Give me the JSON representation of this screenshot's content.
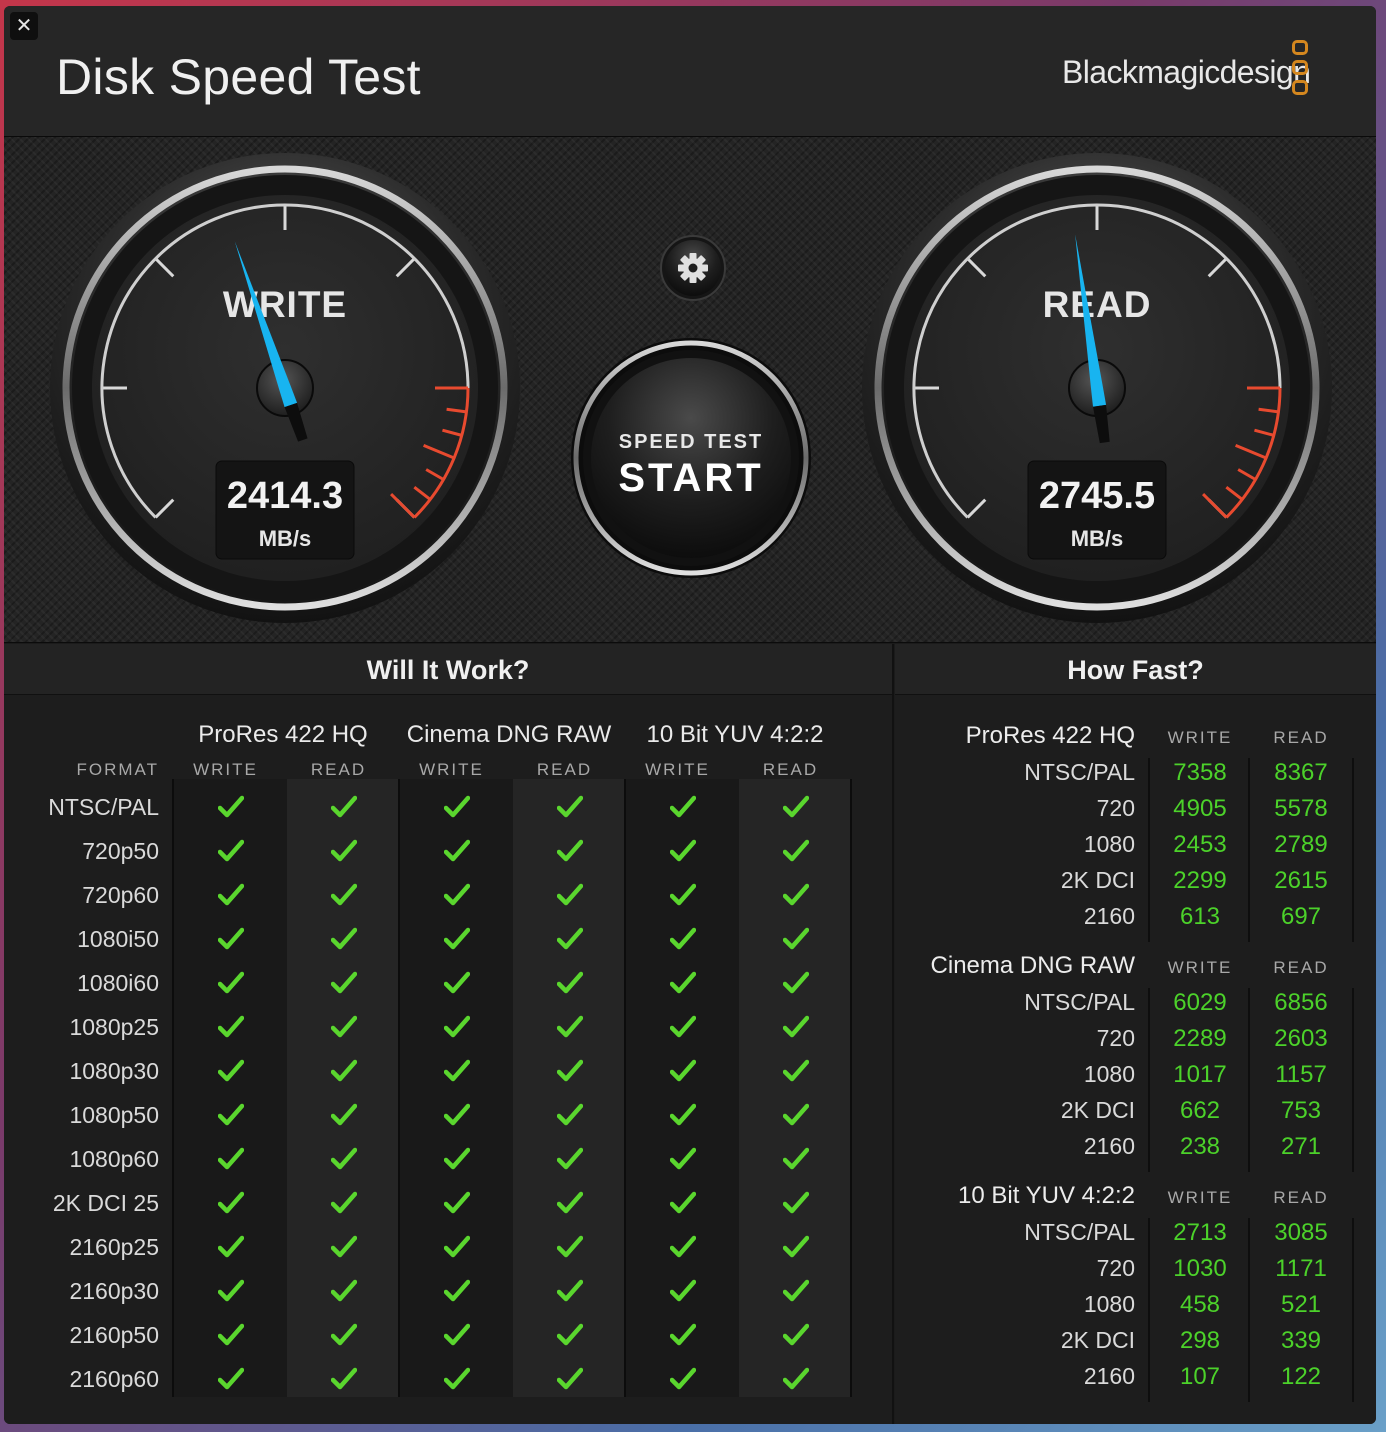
{
  "window": {
    "title": "Disk Speed Test",
    "brand": "Blackmagicdesign",
    "close_glyph": "✕"
  },
  "gauges": {
    "write": {
      "label": "WRITE",
      "value": "2414.3",
      "unit": "MB/s",
      "needle_fraction": 0.43
    },
    "read": {
      "label": "READ",
      "value": "2745.5",
      "unit": "MB/s",
      "needle_fraction": 0.47
    }
  },
  "settings": {
    "icon": "gear-icon"
  },
  "start_button": {
    "subtitle": "SPEED TEST",
    "label": "START"
  },
  "colors": {
    "accent_needle": "#18b4f0",
    "redline": "#e84a2f",
    "check": "#5ad62e",
    "value_green": "#4cd22a",
    "logo": "#d4871f"
  },
  "will_it_work": {
    "title": "Will It Work?",
    "format_header": "FORMAT",
    "groups": [
      {
        "name": "ProRes 422 HQ",
        "write": "WRITE",
        "read": "READ"
      },
      {
        "name": "Cinema DNG RAW",
        "write": "WRITE",
        "read": "READ"
      },
      {
        "name": "10 Bit YUV 4:2:2",
        "write": "WRITE",
        "read": "READ"
      }
    ],
    "rows": [
      "NTSC/PAL",
      "720p50",
      "720p60",
      "1080i50",
      "1080i60",
      "1080p25",
      "1080p30",
      "1080p50",
      "1080p60",
      "2K DCI 25",
      "2160p25",
      "2160p30",
      "2160p50",
      "2160p60"
    ],
    "all_supported": true
  },
  "how_fast": {
    "title": "How Fast?",
    "groups": [
      {
        "name": "ProRes 422 HQ",
        "write_label": "WRITE",
        "read_label": "READ",
        "rows": [
          {
            "format": "NTSC/PAL",
            "write": "7358",
            "read": "8367"
          },
          {
            "format": "720",
            "write": "4905",
            "read": "5578"
          },
          {
            "format": "1080",
            "write": "2453",
            "read": "2789"
          },
          {
            "format": "2K DCI",
            "write": "2299",
            "read": "2615"
          },
          {
            "format": "2160",
            "write": "613",
            "read": "697"
          }
        ]
      },
      {
        "name": "Cinema DNG RAW",
        "write_label": "WRITE",
        "read_label": "READ",
        "rows": [
          {
            "format": "NTSC/PAL",
            "write": "6029",
            "read": "6856"
          },
          {
            "format": "720",
            "write": "2289",
            "read": "2603"
          },
          {
            "format": "1080",
            "write": "1017",
            "read": "1157"
          },
          {
            "format": "2K DCI",
            "write": "662",
            "read": "753"
          },
          {
            "format": "2160",
            "write": "238",
            "read": "271"
          }
        ]
      },
      {
        "name": "10 Bit YUV 4:2:2",
        "write_label": "WRITE",
        "read_label": "READ",
        "rows": [
          {
            "format": "NTSC/PAL",
            "write": "2713",
            "read": "3085"
          },
          {
            "format": "720",
            "write": "1030",
            "read": "1171"
          },
          {
            "format": "1080",
            "write": "458",
            "read": "521"
          },
          {
            "format": "2K DCI",
            "write": "298",
            "read": "339"
          },
          {
            "format": "2160",
            "write": "107",
            "read": "122"
          }
        ]
      }
    ]
  }
}
